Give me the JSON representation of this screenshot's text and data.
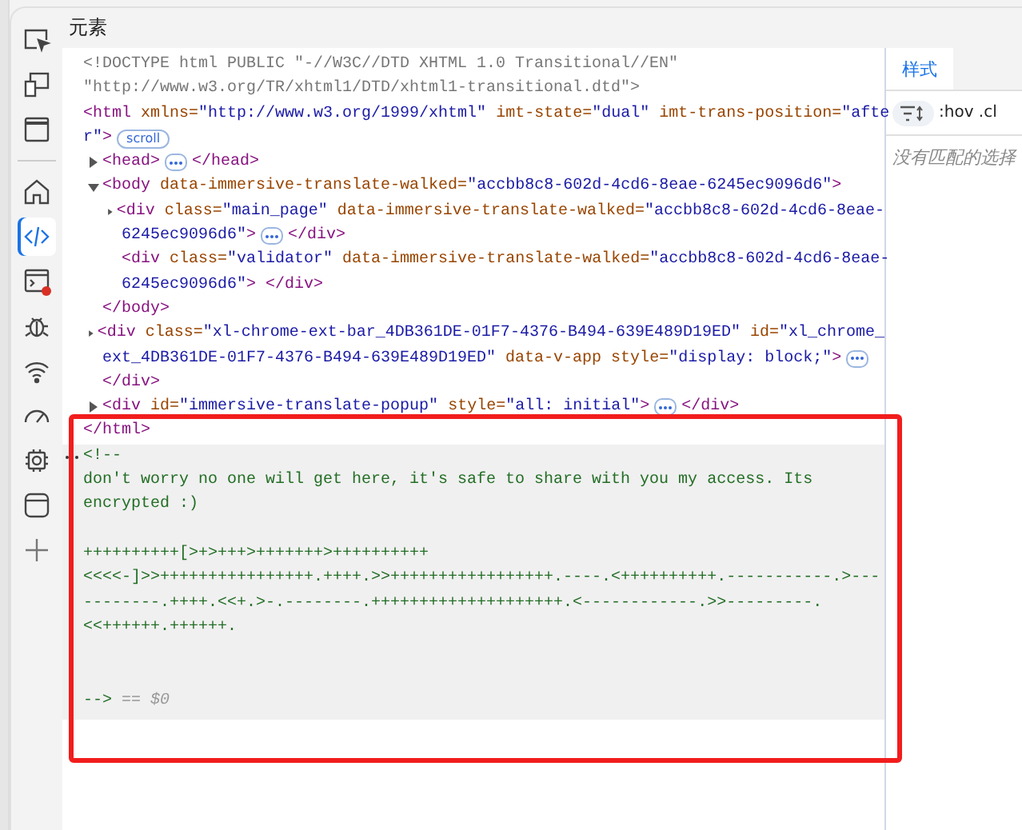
{
  "panel": {
    "title": "元素"
  },
  "rail": [
    {
      "kind": "inspect",
      "selected": false
    },
    {
      "kind": "device",
      "selected": false
    },
    {
      "kind": "window",
      "selected": false
    },
    {
      "kind": "divider"
    },
    {
      "kind": "home",
      "selected": false
    },
    {
      "kind": "code",
      "selected": true
    },
    {
      "kind": "console",
      "selected": false
    },
    {
      "kind": "bug",
      "selected": false
    },
    {
      "kind": "wifi",
      "selected": false
    },
    {
      "kind": "gauge",
      "selected": false
    },
    {
      "kind": "chip",
      "selected": false
    },
    {
      "kind": "database",
      "selected": false
    },
    {
      "kind": "plus",
      "selected": false
    }
  ],
  "tree": [
    {
      "lines": [
        [
          {
            "kind": "doctype",
            "text": "<!DOCTYPE html PUBLIC \"-//W3C//DTD XHTML 1.0 Transitional//EN\""
          }
        ],
        [
          {
            "kind": "doctype",
            "text": "\"http://www.w3.org/TR/xhtml1/DTD/xhtml1-transitional.dtd\">"
          }
        ]
      ]
    },
    {
      "lines": [
        [
          {
            "kind": "tag",
            "text": "<html"
          },
          {
            "kind": "attr",
            "text": " xmlns="
          },
          {
            "kind": "value",
            "text": "\"http://www.w3.org/1999/xhtml\""
          },
          {
            "kind": "attr",
            "text": " imt-state="
          },
          {
            "kind": "value",
            "text": "\"dual\""
          },
          {
            "kind": "attr",
            "text": " imt-trans-position="
          },
          {
            "kind": "value",
            "text": "\"afte"
          }
        ],
        [
          {
            "kind": "value",
            "text": "r\""
          },
          {
            "kind": "tag",
            "text": ">"
          },
          {
            "kind": "badge",
            "text": "scroll"
          }
        ]
      ],
      "close": [
        {
          "kind": "tag",
          "text": "</html>"
        }
      ],
      "children": [
        {
          "expanded": false,
          "lines": [
            [
              {
                "kind": "tag",
                "text": "<head>"
              },
              {
                "kind": "ellipsis"
              },
              {
                "kind": "tag",
                "text": "</head>"
              }
            ]
          ]
        },
        {
          "expanded": true,
          "lines": [
            [
              {
                "kind": "tag",
                "text": "<body"
              },
              {
                "kind": "attr",
                "text": " data-immersive-translate-walked="
              },
              {
                "kind": "value",
                "text": "\"accbb8c8-602d-4cd6-8eae-6245ec9096d6\""
              },
              {
                "kind": "tag",
                "text": ">"
              }
            ]
          ],
          "close": [
            {
              "kind": "tag",
              "text": "</body>"
            }
          ],
          "children": [
            {
              "expanded": false,
              "lines": [
                [
                  {
                    "kind": "tag",
                    "text": "<div"
                  },
                  {
                    "kind": "attr",
                    "text": " class="
                  },
                  {
                    "kind": "value",
                    "text": "\"main_page\""
                  },
                  {
                    "kind": "attr",
                    "text": " data-immersive-translate-walked="
                  },
                  {
                    "kind": "value",
                    "text": "\"accbb8c8-602d-4cd6-8eae-"
                  }
                ],
                [
                  {
                    "kind": "value",
                    "text": "6245ec9096d6\""
                  },
                  {
                    "kind": "tag",
                    "text": ">"
                  },
                  {
                    "kind": "ellipsis"
                  },
                  {
                    "kind": "tag",
                    "text": "</div>"
                  }
                ]
              ]
            },
            {
              "lines": [
                [
                  {
                    "kind": "tag",
                    "text": "<div"
                  },
                  {
                    "kind": "attr",
                    "text": " class="
                  },
                  {
                    "kind": "value",
                    "text": "\"validator\""
                  },
                  {
                    "kind": "attr",
                    "text": " data-immersive-translate-walked="
                  },
                  {
                    "kind": "value",
                    "text": "\"accbb8c8-602d-4cd6-8eae-"
                  }
                ],
                [
                  {
                    "kind": "value",
                    "text": "6245ec9096d6\""
                  },
                  {
                    "kind": "tag",
                    "text": "> </div>"
                  }
                ]
              ]
            }
          ]
        },
        {
          "expanded": false,
          "lines": [
            [
              {
                "kind": "tag",
                "text": "<div"
              },
              {
                "kind": "attr",
                "text": " class="
              },
              {
                "kind": "value",
                "text": "\"xl-chrome-ext-bar_4DB361DE-01F7-4376-B494-639E489D19ED\""
              },
              {
                "kind": "attr",
                "text": " id="
              },
              {
                "kind": "value",
                "text": "\"xl_chrome_"
              }
            ],
            [
              {
                "kind": "value",
                "text": "ext_4DB361DE-01F7-4376-B494-639E489D19ED\""
              },
              {
                "kind": "attr",
                "text": " data-v-app style="
              },
              {
                "kind": "value",
                "text": "\"display: block;\""
              },
              {
                "kind": "tag",
                "text": ">"
              },
              {
                "kind": "ellipsis"
              }
            ]
          ],
          "close": [
            {
              "kind": "tag",
              "text": "</div>"
            }
          ]
        },
        {
          "expanded": false,
          "lines": [
            [
              {
                "kind": "tag",
                "text": "<div"
              },
              {
                "kind": "attr",
                "text": " id="
              },
              {
                "kind": "value",
                "text": "\"immersive-translate-popup\""
              },
              {
                "kind": "attr",
                "text": " style="
              },
              {
                "kind": "value",
                "text": "\"all: initial\""
              },
              {
                "kind": "tag",
                "text": ">"
              },
              {
                "kind": "ellipsis"
              },
              {
                "kind": "tag",
                "text": "</div>"
              }
            ]
          ]
        }
      ]
    },
    {
      "kind": "comment",
      "selected": true,
      "open": "<!--",
      "close": "-->",
      "marker": "== $0",
      "paragraphs": [
        [
          {
            "kind": "prose",
            "text": "don't worry no one will get here, it's safe to share with you my access. Its encrypted :)"
          }
        ],
        [
          {
            "kind": "code",
            "text": "++++++++++[>+>+++>+++++++>++++++++++"
          },
          {
            "kind": "code",
            "text": "<<<<-]>>++++++++++++++++.++++.>>+++++++++++++++++.----.<++++++++++.-----------.>-----------.++++.<<+.>-.--------.++++++++++++++++++++.<------------.>>---------."
          },
          {
            "kind": "code",
            "text": "<<++++++.++++++."
          }
        ]
      ]
    }
  ],
  "styles": {
    "tabs": [
      {
        "label": "样式",
        "selected": true
      }
    ],
    "filter_tools": ":hov .cl",
    "empty_message": "没有匹配的选择"
  }
}
